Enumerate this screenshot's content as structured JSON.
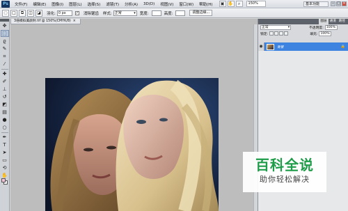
{
  "menubar": {
    "logo": "Ps",
    "items": [
      "文件(F)",
      "编辑(E)",
      "图像(I)",
      "图层(L)",
      "选择(S)",
      "滤镜(T)",
      "分析(A)",
      "3D(D)",
      "视图(V)",
      "窗口(W)",
      "帮助(H)"
    ],
    "zoom": "150%",
    "workspace": "基本功能"
  },
  "options": {
    "feather_label": "羽化:",
    "feather_value": "0 px",
    "antialias_label": "消除锯齿",
    "style_label": "样式:",
    "style_value": "正常",
    "width_label": "宽度:",
    "height_label": "高度:",
    "refine_label": "调整边缘..."
  },
  "document": {
    "tab_title": "3倍模拟美颜封.tif @ 150%(CMYK/8)",
    "close_glyph": "×"
  },
  "panels": {
    "tabs": [
      "图层",
      "通道",
      "路径"
    ],
    "blend_mode": "正常",
    "opacity_label": "不透明度:",
    "opacity_value": "100%",
    "lock_label": "锁定:",
    "fill_label": "填充:",
    "fill_value": "100%",
    "layer_name": "背景"
  },
  "watermark": {
    "title": "百科全说",
    "subtitle": "助你轻松解决"
  },
  "colors": {
    "accent": "#3d83df",
    "watermark_green": "#1f9c49",
    "foreground_swatch": "#f2c2d4"
  }
}
